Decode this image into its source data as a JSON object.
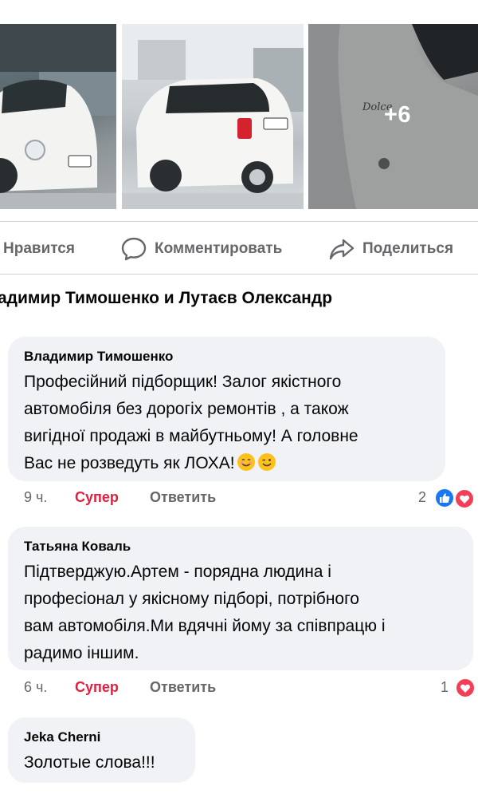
{
  "photos": {
    "more_count": "+6",
    "badge_text": "Dolce"
  },
  "actions": {
    "like_label": "Нравится",
    "comment_label": "Комментировать",
    "share_label": "Поделиться"
  },
  "reactors_line": "адимир Тимошенко и Лутаєв Олександр",
  "comments": [
    {
      "author": "Владимир Тимошенко",
      "lines": [
        "Професійний підборщик! Залог якістного",
        "автомобіля без дорогіх ремонтів , а також",
        "вигідної продажі в майбутньому! А головне",
        "Вас не розведуть як ЛОХА!"
      ],
      "emojis": [
        "smiling-face-icon",
        "winking-face-icon"
      ],
      "time": "9 ч.",
      "reaction_label": "Супер",
      "reply_label": "Ответить",
      "reaction_count": "2",
      "reaction_icons": [
        "like-reaction-icon",
        "love-reaction-icon"
      ]
    },
    {
      "author": "Татьяна Коваль",
      "lines": [
        "Підтверджую.Артем - порядна людина і",
        "професіонал у якісному підборі, потрібного",
        "вам автомобіля.Ми вдячні йому за співпрацю і",
        "радимо іншим."
      ],
      "time": "6 ч.",
      "reaction_label": "Супер",
      "reply_label": "Ответить",
      "reaction_count": "1",
      "reaction_icons": [
        "love-reaction-icon"
      ]
    },
    {
      "author": "Jeka Cherni",
      "lines": [
        "Золотые слова!!!"
      ]
    }
  ],
  "colors": {
    "text": "#050505",
    "secondary": "#65676b",
    "bubble": "#f0f2f5",
    "super_red": "#e41e3f",
    "like_blue": "#1877f2",
    "love_red": "#f33e58"
  }
}
